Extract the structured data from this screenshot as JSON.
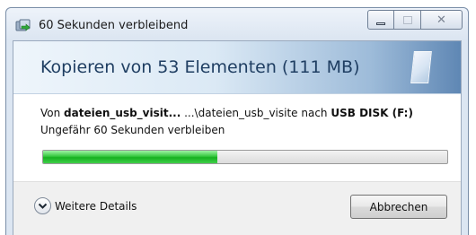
{
  "window": {
    "title": "60 Sekunden verbleibend",
    "controls": {
      "minimize_icon": "minimize-icon",
      "maximize_icon": "maximize-icon",
      "close_icon": "close-icon"
    }
  },
  "header": {
    "title": "Kopieren von 53 Elementen (111 MB)"
  },
  "copy": {
    "prefix": "Von ",
    "source_name": "dateien_usb_visit...",
    "path": " ...\\dateien_usb_visite nach ",
    "destination": "USB DISK (F:)",
    "remaining": "Ungefähr 60 Sekunden verbleiben"
  },
  "progress": {
    "fraction": 0.43,
    "color": "#16b020"
  },
  "footer": {
    "details_label": "Weitere Details",
    "cancel_label": "Abbrechen"
  }
}
